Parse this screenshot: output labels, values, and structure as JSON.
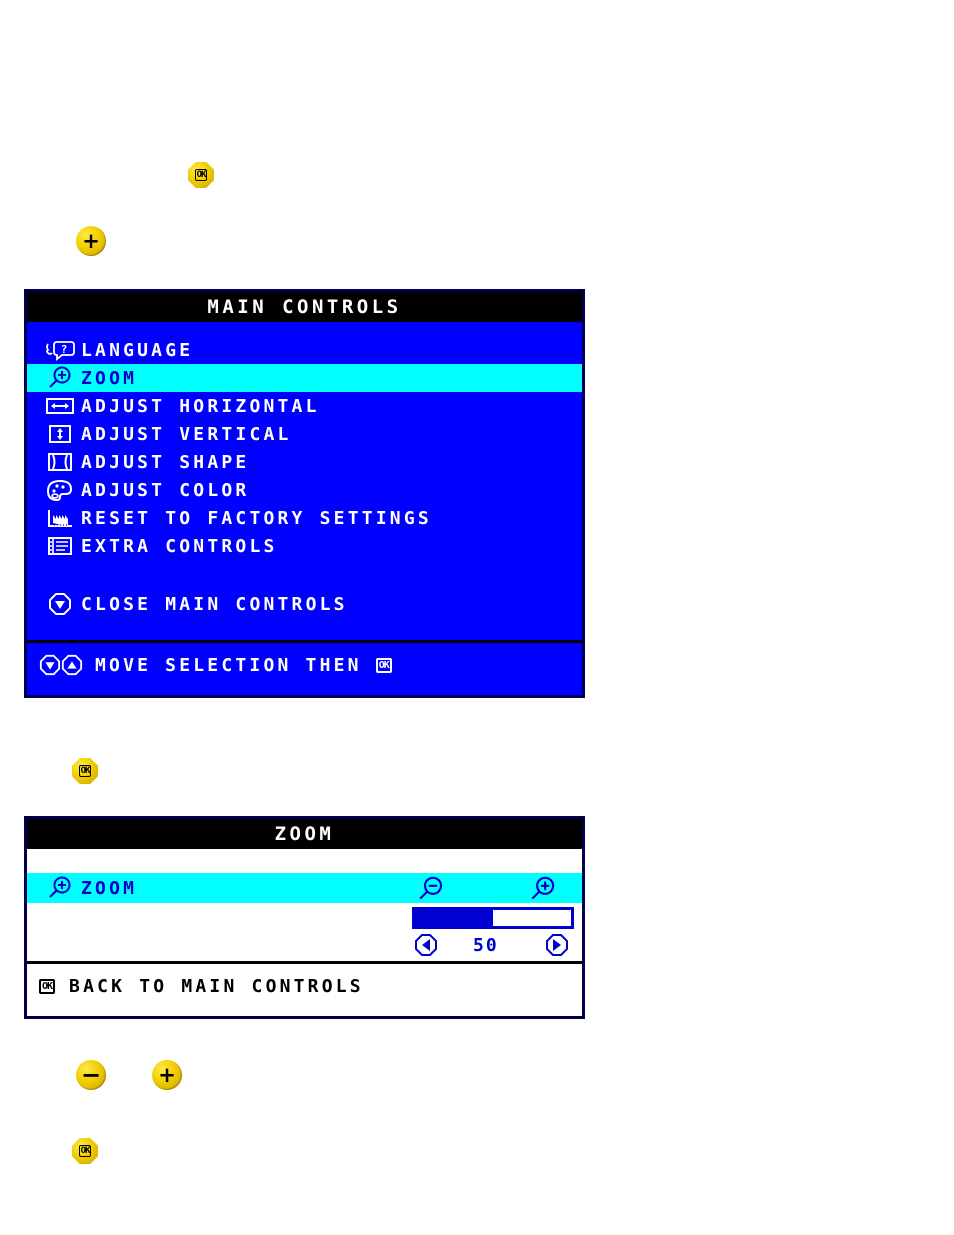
{
  "buttons": {
    "ok_top": {
      "name": "OK",
      "glyph": "ok-button-icon"
    },
    "plus_top": {
      "name": "+",
      "glyph": "plus-button-icon"
    },
    "ok_mid": {
      "name": "OK",
      "glyph": "ok-button-icon"
    },
    "minus_bottom": {
      "name": "−",
      "glyph": "minus-button-icon"
    },
    "plus_bottom": {
      "name": "+",
      "glyph": "plus-button-icon"
    },
    "ok_bottom": {
      "name": "OK",
      "glyph": "ok-button-icon"
    }
  },
  "main_controls": {
    "title": "MAIN CONTROLS",
    "items": [
      {
        "label": "LANGUAGE",
        "icon": "language-speech-bubble-icon",
        "selected": false
      },
      {
        "label": "ZOOM",
        "icon": "magnifier-plus-icon",
        "selected": true
      },
      {
        "label": "ADJUST HORIZONTAL",
        "icon": "horizontal-arrows-icon",
        "selected": false
      },
      {
        "label": "ADJUST VERTICAL",
        "icon": "vertical-arrows-icon",
        "selected": false
      },
      {
        "label": "ADJUST SHAPE",
        "icon": "pincushion-shape-icon",
        "selected": false
      },
      {
        "label": "ADJUST COLOR",
        "icon": "color-palette-icon",
        "selected": false
      },
      {
        "label": "RESET TO FACTORY SETTINGS",
        "icon": "factory-icon",
        "selected": false
      },
      {
        "label": "EXTRA CONTROLS",
        "icon": "list-document-icon",
        "selected": false
      }
    ],
    "close_item": {
      "label": "CLOSE MAIN CONTROLS",
      "icon": "down-arrow-circle-icon"
    },
    "footer": {
      "text_before": "MOVE SELECTION THEN",
      "ok_label": "OK",
      "icons": [
        "down-arrow-circle-icon",
        "up-arrow-circle-icon"
      ]
    }
  },
  "zoom_panel": {
    "title": "ZOOM",
    "row": {
      "label": "ZOOM",
      "icon": "magnifier-plus-icon",
      "decrease_icon": "magnifier-minus-icon",
      "increase_icon": "magnifier-plus-icon"
    },
    "slider": {
      "value": 50,
      "min": 0,
      "max": 100,
      "fill_percent": 50
    },
    "value_text": "50",
    "left_arrow_icon": "left-triangle-circle-icon",
    "right_arrow_icon": "right-triangle-circle-icon",
    "footer": {
      "ok_label": "OK",
      "text": "BACK TO MAIN CONTROLS"
    }
  },
  "colors": {
    "osd_blue": "#0000ff",
    "highlight_cyan": "#00ffff",
    "title_black": "#000000",
    "text_white": "#ffffff",
    "text_blue": "#0000d0",
    "button_yellow": "#f2cf00",
    "panel_white": "#ffffff"
  }
}
